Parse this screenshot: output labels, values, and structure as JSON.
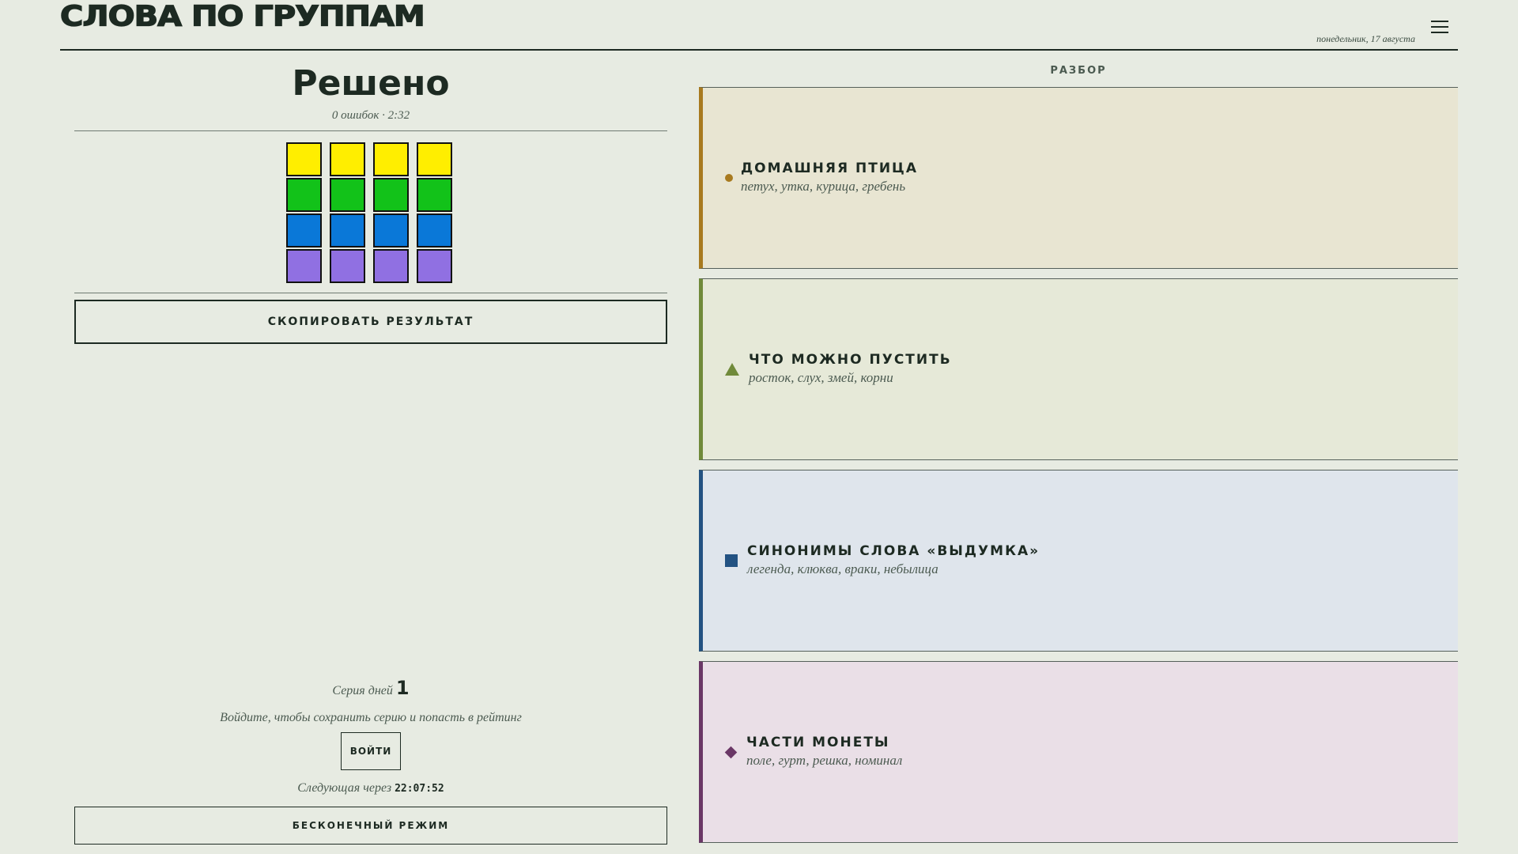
{
  "header": {
    "logo": "СЛОВА ПО ГРУППАМ",
    "date": "понедельник, 17 августа",
    "menu_icon": "hamburger-menu-icon"
  },
  "result": {
    "title": "Решено",
    "subtitle": "0 ошибок · 2:32",
    "grid_rows": [
      {
        "color": "#ffee00"
      },
      {
        "color": "#12c219"
      },
      {
        "color": "#0a78d8"
      },
      {
        "color": "#9070e2"
      }
    ],
    "copy_button": "СКОПИРОВАТЬ РЕЗУЛЬТАТ"
  },
  "streak": {
    "label": "Серия дней",
    "value": "1",
    "login_hint": "Войдите, чтобы сохранить серию и попасть в рейтинг",
    "login_button": "ВОЙТИ",
    "next_label": "Следующая через",
    "next_time": "22:07:52",
    "endless_button": "БЕСКОНЕЧНЫЙ РЕЖИМ"
  },
  "analysis": {
    "label": "РАЗБОР",
    "groups": [
      {
        "title": "ДОМАШНЯЯ ПТИЦА",
        "words": "петух, утка, курица, гребень",
        "accent": "#a87a1f",
        "bg": "#e8e5d2",
        "marker": "circle"
      },
      {
        "title": "ЧТО МОЖНО ПУСТИТЬ",
        "words": "росток, слух, змей, корни",
        "accent": "#708a3a",
        "bg": "#e6e9d8",
        "marker": "triangle"
      },
      {
        "title": "СИНОНИМЫ СЛОВА «ВЫДУМКА»",
        "words": "легенда, клюква, враки, небылица",
        "accent": "#235282",
        "bg": "#dfe5ec",
        "marker": "square"
      },
      {
        "title": "ЧАСТИ МОНЕТЫ",
        "words": "поле, гурт, решка, номинал",
        "accent": "#6a3766",
        "bg": "#eadfe7",
        "marker": "diamond"
      }
    ]
  }
}
